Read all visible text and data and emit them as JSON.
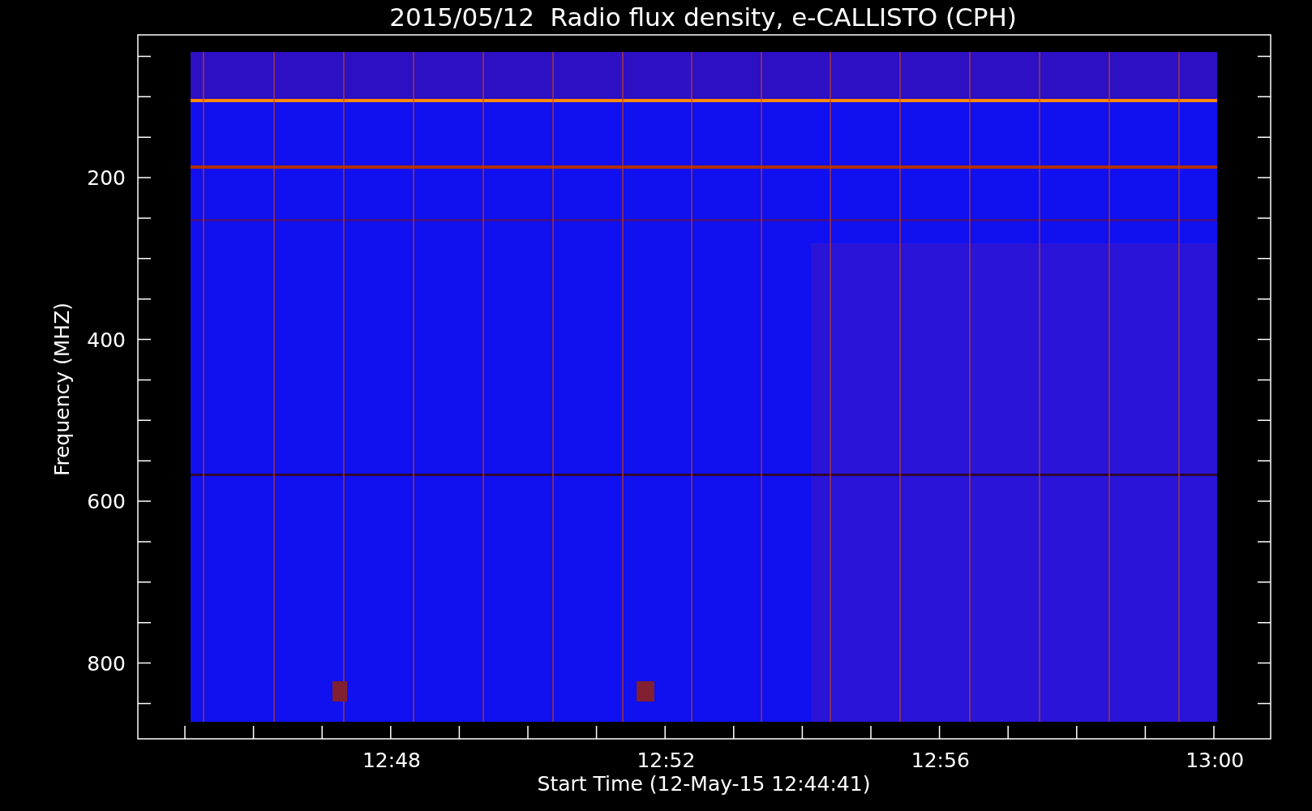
{
  "title": "2015/05/12  Radio flux density, e-CALLISTO (CPH)",
  "y_axis": {
    "label": "Frequency (MHZ)",
    "ticks": [
      "200",
      "400",
      "600",
      "800"
    ]
  },
  "x_axis": {
    "label": "Start Time (12-May-15 12:44:41)",
    "ticks": [
      "12:48",
      "12:52",
      "12:56",
      "13:00"
    ]
  }
}
